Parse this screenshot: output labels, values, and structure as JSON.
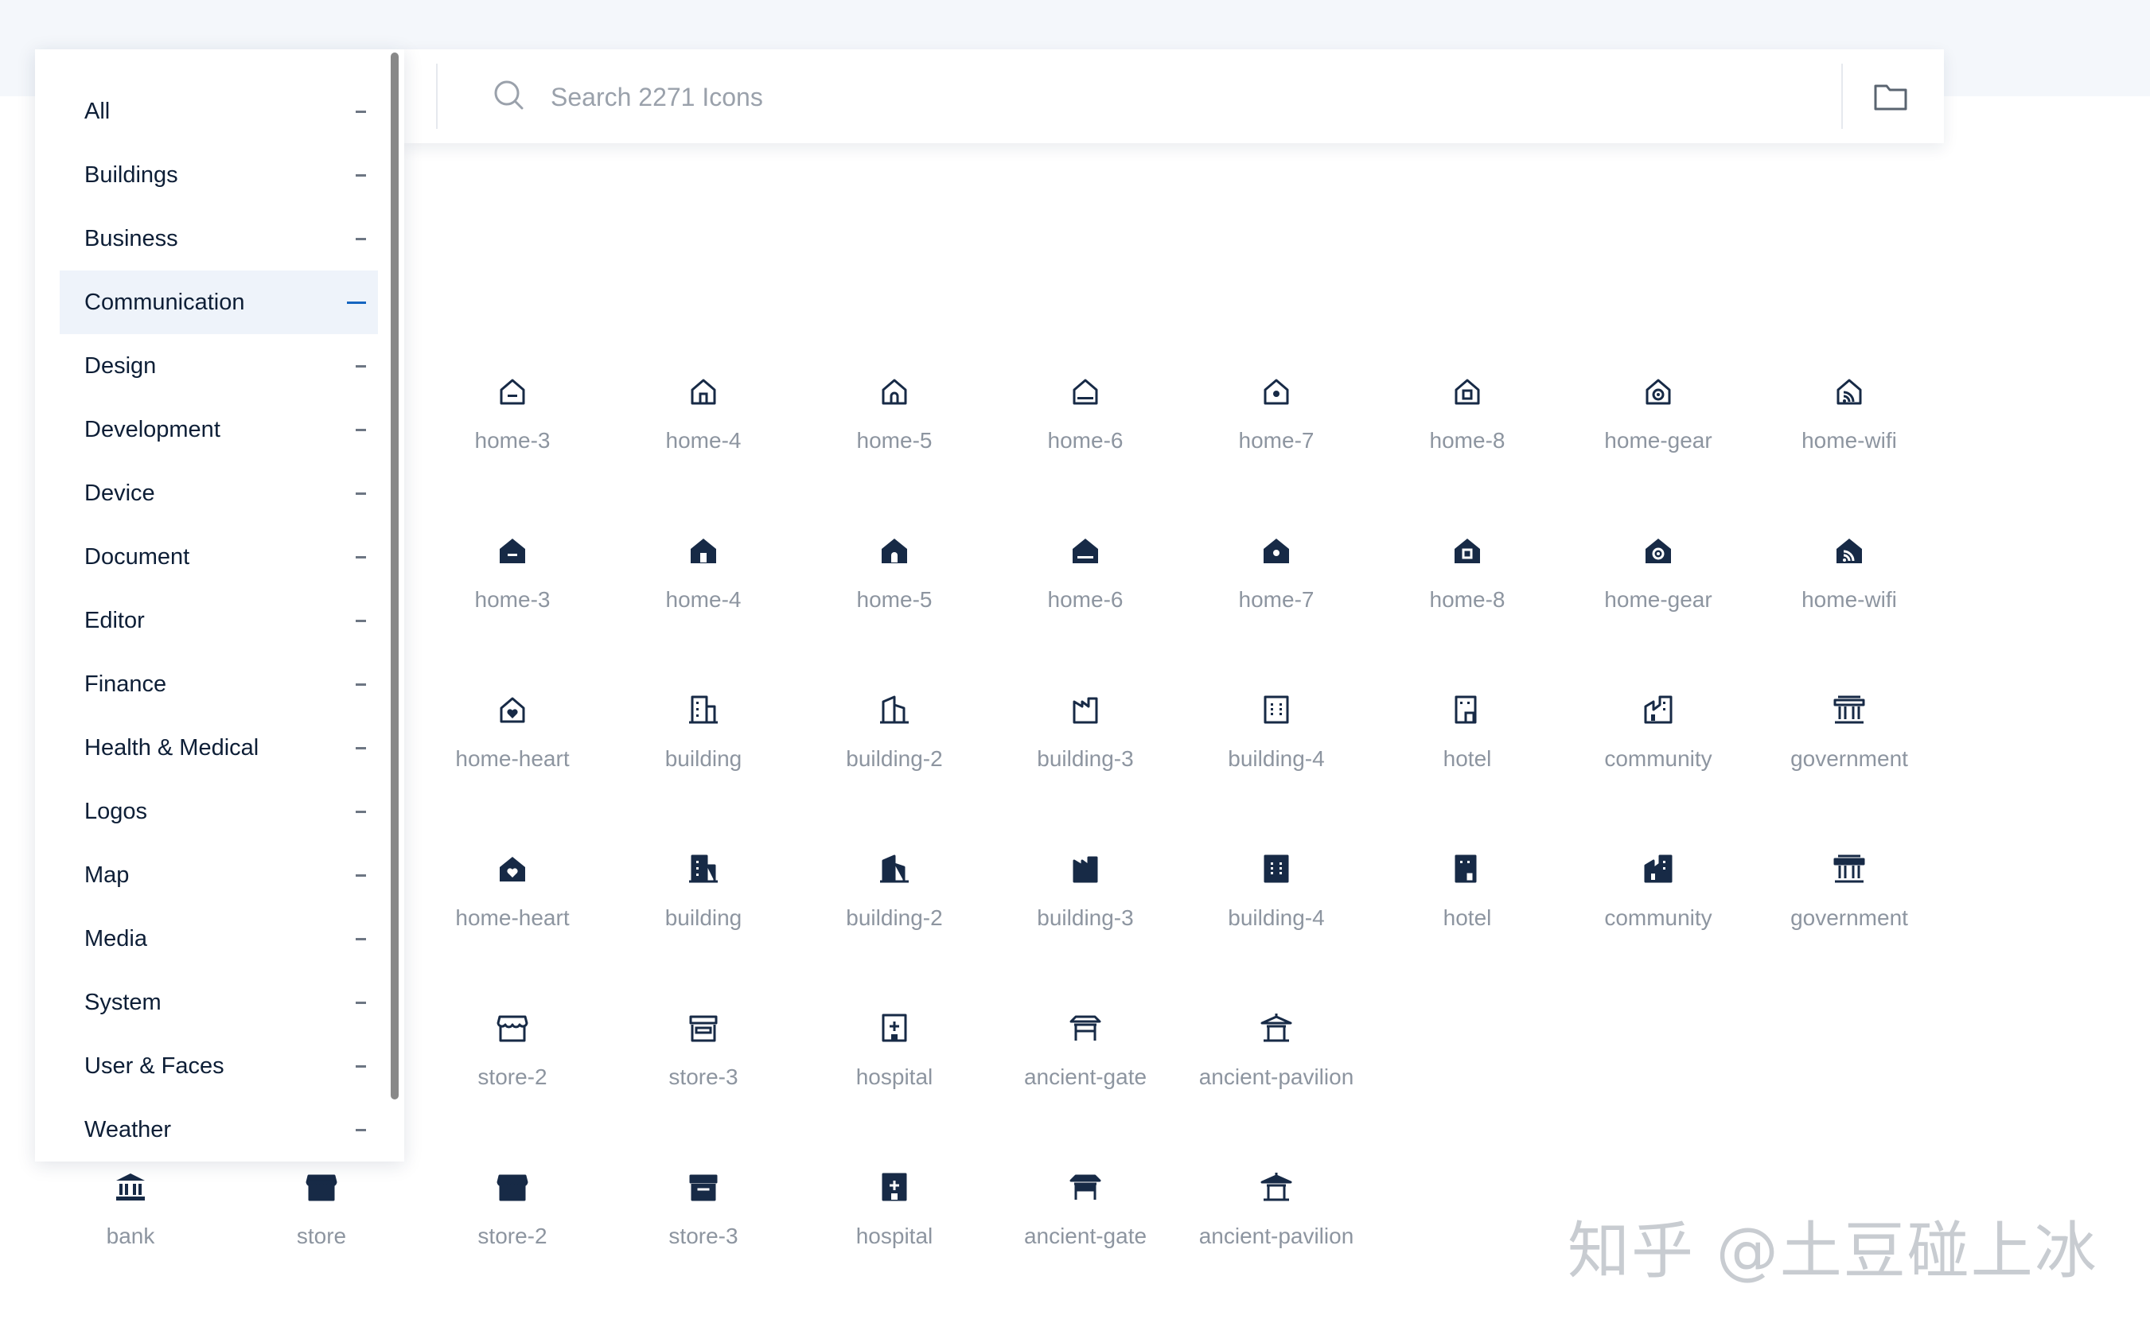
{
  "search": {
    "placeholder": "Search 2271 Icons"
  },
  "sidebar": {
    "items": [
      {
        "label": "All"
      },
      {
        "label": "Buildings"
      },
      {
        "label": "Business"
      },
      {
        "label": "Communication",
        "active": true
      },
      {
        "label": "Design"
      },
      {
        "label": "Development"
      },
      {
        "label": "Device"
      },
      {
        "label": "Document"
      },
      {
        "label": "Editor"
      },
      {
        "label": "Finance"
      },
      {
        "label": "Health & Medical"
      },
      {
        "label": "Logos"
      },
      {
        "label": "Map"
      },
      {
        "label": "Media"
      },
      {
        "label": "System"
      },
      {
        "label": "User & Faces"
      },
      {
        "label": "Weather"
      }
    ]
  },
  "icons": {
    "rows": [
      [
        {
          "label": "home-3",
          "icon": "home-3-line-icon"
        },
        {
          "label": "home-4",
          "icon": "home-4-line-icon"
        },
        {
          "label": "home-5",
          "icon": "home-5-line-icon"
        },
        {
          "label": "home-6",
          "icon": "home-6-line-icon"
        },
        {
          "label": "home-7",
          "icon": "home-7-line-icon"
        },
        {
          "label": "home-8",
          "icon": "home-8-line-icon"
        },
        {
          "label": "home-gear",
          "icon": "home-gear-line-icon"
        },
        {
          "label": "home-wifi",
          "icon": "home-wifi-line-icon"
        }
      ],
      [
        {
          "label": "home-3",
          "icon": "home-3-fill-icon"
        },
        {
          "label": "home-4",
          "icon": "home-4-fill-icon"
        },
        {
          "label": "home-5",
          "icon": "home-5-fill-icon"
        },
        {
          "label": "home-6",
          "icon": "home-6-fill-icon"
        },
        {
          "label": "home-7",
          "icon": "home-7-fill-icon"
        },
        {
          "label": "home-8",
          "icon": "home-8-fill-icon"
        },
        {
          "label": "home-gear",
          "icon": "home-gear-fill-icon"
        },
        {
          "label": "home-wifi",
          "icon": "home-wifi-fill-icon"
        }
      ],
      [
        {
          "label": "home-heart",
          "icon": "home-heart-line-icon"
        },
        {
          "label": "building",
          "icon": "building-line-icon"
        },
        {
          "label": "building-2",
          "icon": "building-2-line-icon"
        },
        {
          "label": "building-3",
          "icon": "building-3-line-icon"
        },
        {
          "label": "building-4",
          "icon": "building-4-line-icon"
        },
        {
          "label": "hotel",
          "icon": "hotel-line-icon"
        },
        {
          "label": "community",
          "icon": "community-line-icon"
        },
        {
          "label": "government",
          "icon": "government-line-icon"
        }
      ],
      [
        {
          "label": "home-heart",
          "icon": "home-heart-fill-icon"
        },
        {
          "label": "building",
          "icon": "building-fill-icon"
        },
        {
          "label": "building-2",
          "icon": "building-2-fill-icon"
        },
        {
          "label": "building-3",
          "icon": "building-3-fill-icon"
        },
        {
          "label": "building-4",
          "icon": "building-4-fill-icon"
        },
        {
          "label": "hotel",
          "icon": "hotel-fill-icon"
        },
        {
          "label": "community",
          "icon": "community-fill-icon"
        },
        {
          "label": "government",
          "icon": "government-fill-icon"
        }
      ],
      [
        {
          "label": "store-2",
          "icon": "store-2-line-icon"
        },
        {
          "label": "store-3",
          "icon": "store-3-line-icon"
        },
        {
          "label": "hospital",
          "icon": "hospital-line-icon"
        },
        {
          "label": "ancient-gate",
          "icon": "ancient-gate-line-icon"
        },
        {
          "label": "ancient-pavilion",
          "icon": "ancient-pavilion-line-icon"
        }
      ],
      [
        {
          "label": "bank",
          "icon": "bank-fill-icon"
        },
        {
          "label": "store",
          "icon": "store-fill-icon"
        },
        {
          "label": "store-2",
          "icon": "store-2-fill-icon"
        },
        {
          "label": "store-3",
          "icon": "store-3-fill-icon"
        },
        {
          "label": "hospital",
          "icon": "hospital-fill-icon"
        },
        {
          "label": "ancient-gate",
          "icon": "ancient-gate-fill-icon"
        },
        {
          "label": "ancient-pavilion",
          "icon": "ancient-pavilion-fill-icon"
        }
      ]
    ]
  },
  "watermark": "知乎 @土豆碰上冰",
  "colors": {
    "icon": "#172a46",
    "label": "#8d95a0",
    "active_accent": "#1565c0",
    "active_bg": "#eef3fa",
    "band": "#f4f7fb"
  }
}
